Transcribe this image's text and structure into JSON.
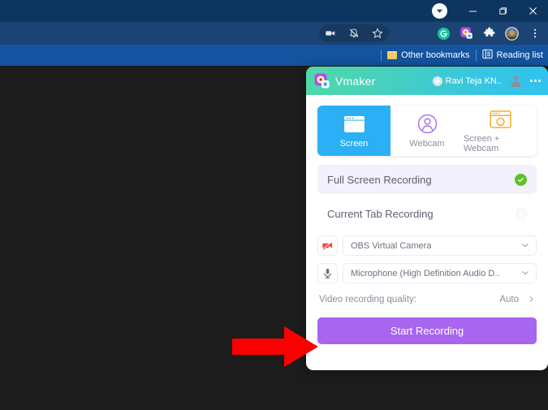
{
  "browser": {
    "window_controls": [
      {
        "name": "profile-chip",
        "glyph": "▼"
      },
      {
        "name": "minimize",
        "glyph": "─"
      },
      {
        "name": "maximize",
        "glyph": "❐"
      },
      {
        "name": "close",
        "glyph": "✕"
      }
    ],
    "toolbar_icons": [
      {
        "name": "media-cast-icon",
        "glyph": "■"
      },
      {
        "name": "notifications-muted-icon",
        "glyph": "⊘"
      },
      {
        "name": "bookmark-star-icon",
        "glyph": "☆"
      },
      {
        "name": "grammarly-extension-icon",
        "glyph": "G"
      },
      {
        "name": "vmaker-extension-icon",
        "glyph": ""
      },
      {
        "name": "extensions-puzzle-icon",
        "glyph": ""
      },
      {
        "name": "profile-avatar-icon",
        "glyph": ""
      },
      {
        "name": "chrome-menu-icon",
        "glyph": "⋮"
      }
    ],
    "bookmarks": {
      "other_bookmarks": "Other bookmarks",
      "reading_list": "Reading list"
    }
  },
  "panel": {
    "header": {
      "brand": "Vmaker",
      "user_name": "Ravi Teja KN..",
      "star_icon": "star-icon",
      "avatar_icon": "avatar-icon",
      "more_icon": "more-options-icon"
    },
    "mode_tabs": [
      {
        "label": "Screen",
        "icon": "screen-window-icon",
        "active": true
      },
      {
        "label": "Webcam",
        "icon": "webcam-person-icon",
        "active": false
      },
      {
        "label": "Screen + Webcam",
        "icon": "screen-webcam-icon",
        "active": false
      }
    ],
    "recording_options": [
      {
        "label": "Full Screen Recording",
        "selected": true
      },
      {
        "label": "Current Tab Recording",
        "selected": false
      }
    ],
    "selects": [
      {
        "icon": "camera-off-icon",
        "value": "OBS Virtual Camera",
        "chevron": "chevron-down-icon"
      },
      {
        "icon": "microphone-icon",
        "value": "Microphone (High Definition Audio D..",
        "chevron": "chevron-down-icon"
      }
    ],
    "quality": {
      "label": "Video recording quality:",
      "value": "Auto",
      "chevron": "chevron-right-icon"
    },
    "cta": {
      "label": "Start Recording"
    }
  },
  "annotation": {
    "arrow": "red-right-arrow",
    "color": "#fb0000"
  },
  "colors": {
    "titlebar": "#0e3560",
    "toolbar": "#1b4373",
    "bookmarkbar": "#14539f",
    "viewport": "#1c1c1c",
    "panel_header_from": "#4fd8a8",
    "panel_header_to": "#30c3ee",
    "tab_active": "#2cb0f5",
    "cta": "#a866f0",
    "check_green": "#5bc327",
    "arrow_red": "#fb0000"
  }
}
